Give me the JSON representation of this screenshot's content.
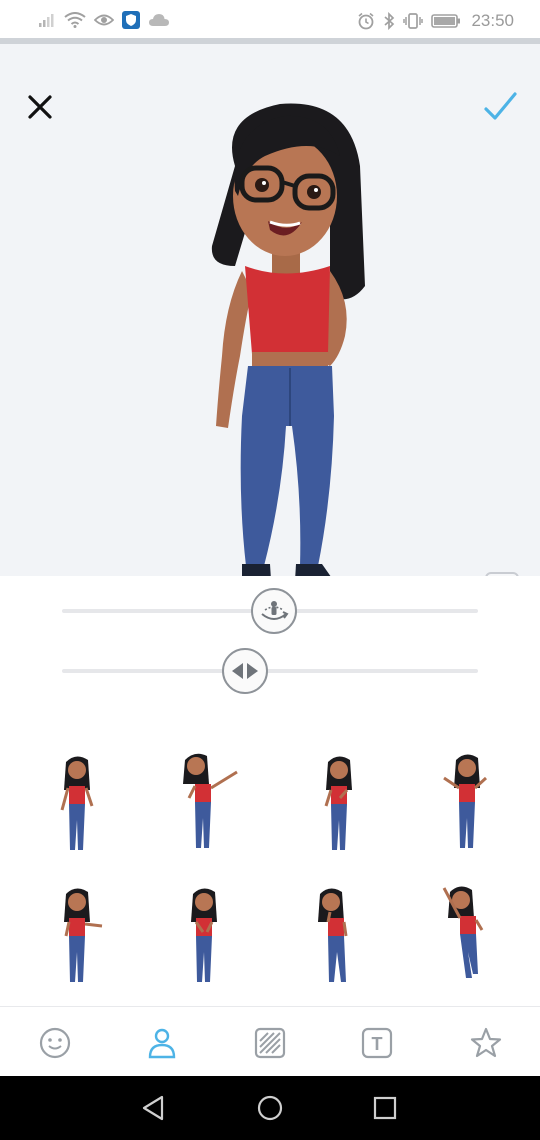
{
  "status_bar": {
    "time": "23:50",
    "icons_left": [
      "signal-icon",
      "wifi-icon",
      "eye-icon",
      "shield-app-icon",
      "cloud-icon"
    ],
    "icons_right": [
      "alarm-icon",
      "bluetooth-icon",
      "vibrate-icon",
      "battery-icon"
    ]
  },
  "header": {
    "close_icon": "close-icon",
    "confirm_icon": "checkmark-icon"
  },
  "preview": {
    "avatar_description_icon": "bitmoji-avatar",
    "body_toggle_icon": "full-body-icon"
  },
  "sliders": [
    {
      "name": "rotate",
      "icon": "rotate-icon",
      "value": 0.46
    },
    {
      "name": "horizontal",
      "icon": "horizontal-arrows-icon",
      "value": 0.39
    }
  ],
  "poses": [
    {
      "id": "pose-1"
    },
    {
      "id": "pose-2"
    },
    {
      "id": "pose-3"
    },
    {
      "id": "pose-4"
    },
    {
      "id": "pose-5"
    },
    {
      "id": "pose-6"
    },
    {
      "id": "pose-7"
    },
    {
      "id": "pose-8"
    }
  ],
  "toolbar": {
    "items": [
      {
        "icon": "smiley-icon",
        "active": false
      },
      {
        "icon": "person-icon",
        "active": true
      },
      {
        "icon": "pattern-icon",
        "active": false
      },
      {
        "icon": "text-icon",
        "active": false
      },
      {
        "icon": "star-icon",
        "active": false
      }
    ],
    "text_tool_label": "T",
    "active_color": "#4db3e6",
    "inactive_color": "#9aa0a6"
  },
  "nav_bar": {
    "buttons": [
      "back-icon",
      "home-icon",
      "recents-icon"
    ]
  }
}
